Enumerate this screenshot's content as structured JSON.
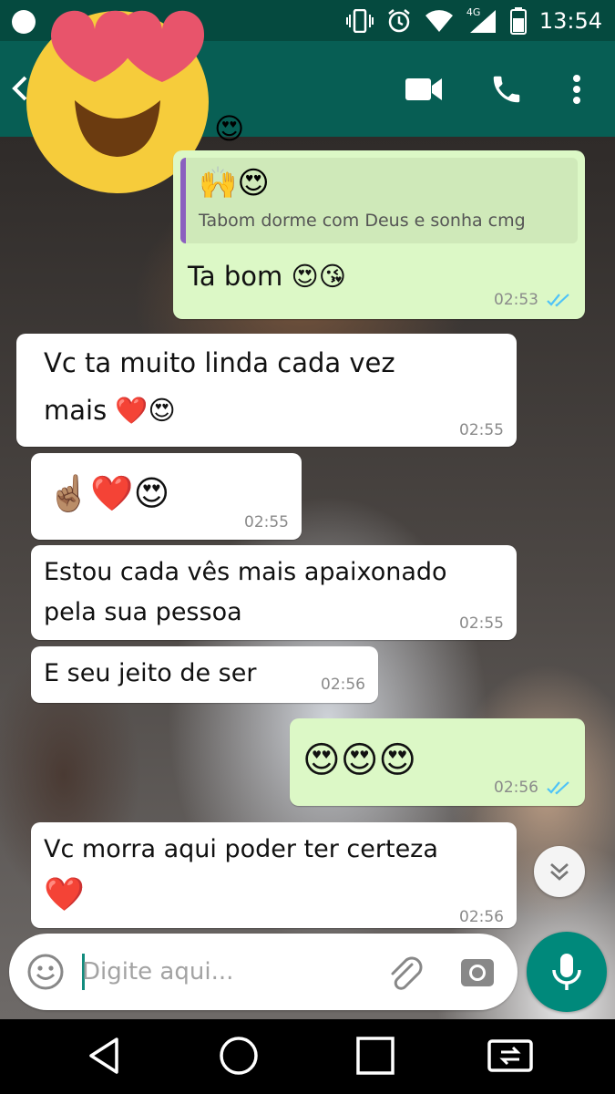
{
  "status_bar": {
    "time": "13:54",
    "network": "4G",
    "icons": [
      "vibrate-icon",
      "alarm-icon",
      "wifi-icon",
      "signal-icon",
      "battery-icon"
    ]
  },
  "header": {
    "contact_emoji": "😍",
    "actions": [
      "video-call-icon",
      "voice-call-icon",
      "menu-icon"
    ]
  },
  "messages": [
    {
      "direction": "out",
      "quote_emoji": "🙌😍",
      "quote_text": "Tabom dorme com Deus e sonha cmg",
      "text": "Ta bom 😍😘",
      "time": "02:53",
      "read": true
    },
    {
      "direction": "in",
      "text_line1": "Vc ta muito linda cada vez",
      "text_line2": "mais ❤️😍",
      "time": "02:55"
    },
    {
      "direction": "in",
      "text": "☝🏽❤️😍",
      "time": "02:55"
    },
    {
      "direction": "in",
      "text_line1": "Estou cada vês mais apaixonado",
      "text_line2": "pela sua pessoa",
      "time": "02:55"
    },
    {
      "direction": "in",
      "text": "E seu jeito de ser",
      "time": "02:56"
    },
    {
      "direction": "out",
      "text": "😍😍😍",
      "time": "02:56",
      "read": true
    },
    {
      "direction": "in",
      "text_line1": "Vc morra aqui poder ter certeza",
      "text_line2": "❤️",
      "time": "02:56"
    }
  ],
  "composer": {
    "placeholder": "Digite aqui..."
  },
  "colors": {
    "header": "#075e54",
    "status_bar": "#054a3f",
    "outgoing_bubble": "#dcf8c6",
    "incoming_bubble": "#ffffff",
    "accent": "#00897b",
    "read_ticks": "#4fc3f7"
  }
}
